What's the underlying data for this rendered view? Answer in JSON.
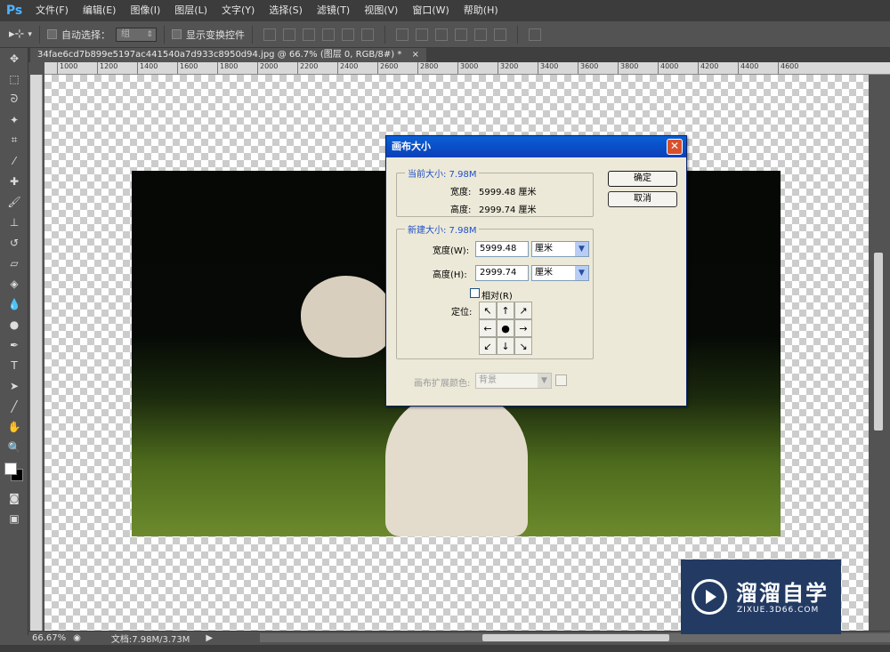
{
  "app": {
    "logo": "Ps"
  },
  "menu": [
    "文件(F)",
    "编辑(E)",
    "图像(I)",
    "图层(L)",
    "文字(Y)",
    "选择(S)",
    "滤镜(T)",
    "视图(V)",
    "窗口(W)",
    "帮助(H)"
  ],
  "options": {
    "auto_select_label": "自动选择：",
    "auto_select_value": "组",
    "show_transform_label": "显示变换控件"
  },
  "document_tab": {
    "title": "34fae6cd7b899e5197ac441540a7d933c8950d94.jpg @ 66.7% (图层 0, RGB/8#) *",
    "close": "×"
  },
  "ruler_ticks": [
    "1000",
    "1200",
    "1400",
    "1600",
    "1800",
    "2000",
    "2200",
    "2400",
    "2600",
    "2800",
    "3000",
    "3200",
    "3400",
    "3600",
    "3800",
    "4000",
    "4200",
    "4400",
    "4600"
  ],
  "status": {
    "zoom": "66.67%",
    "doc": "文档:7.98M/3.73M"
  },
  "dialog": {
    "title": "画布大小",
    "close": "✕",
    "current_size_legend": "当前大小: 7.98M",
    "current_width_label": "宽度:",
    "current_width_value": "5999.48 厘米",
    "current_height_label": "高度:",
    "current_height_value": "2999.74 厘米",
    "new_size_legend": "新建大小: 7.98M",
    "width_label": "宽度(W):",
    "width_value": "5999.48",
    "width_unit": "厘米",
    "height_label": "高度(H):",
    "height_value": "2999.74",
    "height_unit": "厘米",
    "relative_label": "相对(R)",
    "relative_checked": false,
    "anchor_label": "定位:",
    "anchor_arrows": [
      "↖",
      "↑",
      "↗",
      "←",
      "●",
      "→",
      "↙",
      "↓",
      "↘"
    ],
    "extension_color_label": "画布扩展颜色:",
    "extension_color_value": "背景",
    "ok_button": "确定",
    "cancel_button": "取消"
  },
  "watermark": {
    "title": "溜溜自学",
    "subtitle": "ZIXUE.3D66.COM"
  },
  "colors": {
    "accent": "#0a5fd6",
    "highlight_ellipse": "#d6262a",
    "watermark_bg": "#233b63"
  }
}
